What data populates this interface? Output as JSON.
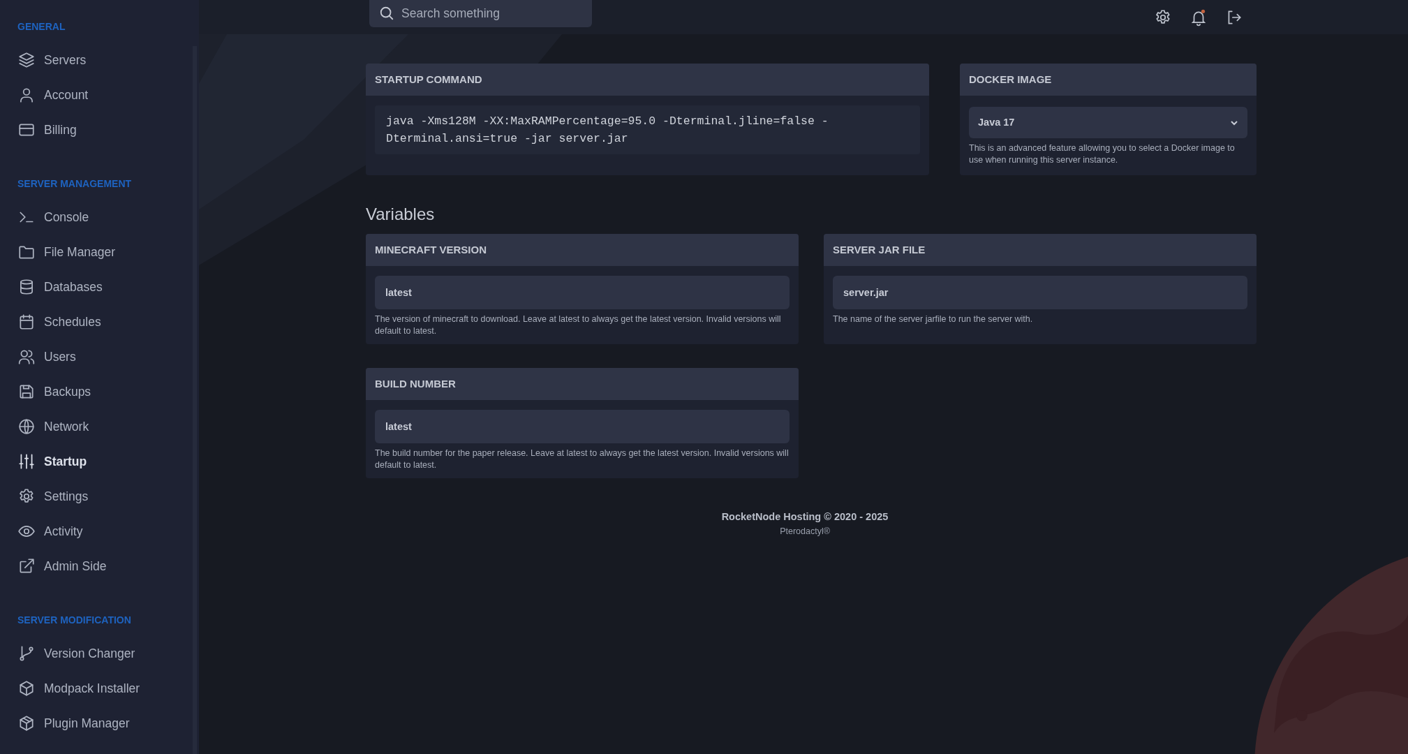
{
  "sidebar": {
    "sections": [
      {
        "heading": "GENERAL",
        "items": [
          {
            "label": "Servers",
            "selected": false
          },
          {
            "label": "Account",
            "selected": false
          },
          {
            "label": "Billing",
            "selected": false
          }
        ]
      },
      {
        "heading": "SERVER MANAGEMENT",
        "items": [
          {
            "label": "Console",
            "selected": false
          },
          {
            "label": "File Manager",
            "selected": false
          },
          {
            "label": "Databases",
            "selected": false
          },
          {
            "label": "Schedules",
            "selected": false
          },
          {
            "label": "Users",
            "selected": false
          },
          {
            "label": "Backups",
            "selected": false
          },
          {
            "label": "Network",
            "selected": false
          },
          {
            "label": "Startup",
            "selected": true
          },
          {
            "label": "Settings",
            "selected": false
          },
          {
            "label": "Activity",
            "selected": false
          },
          {
            "label": "Admin Side",
            "selected": false
          }
        ]
      },
      {
        "heading": "SERVER MODIFICATION",
        "items": [
          {
            "label": "Version Changer",
            "selected": false
          },
          {
            "label": "Modpack Installer",
            "selected": false
          },
          {
            "label": "Plugin Manager",
            "selected": false
          }
        ]
      }
    ]
  },
  "top_bar": {
    "search": {
      "placeholder": "Search something"
    }
  },
  "startup_command": {
    "title": "STARTUP COMMAND",
    "command": "java -Xms128M -XX:MaxRAMPercentage=95.0 -Dterminal.jline=false -Dterminal.ansi=true -jar server.jar"
  },
  "docker_image": {
    "title": "DOCKER IMAGE",
    "value": "Java 17",
    "help": "This is an advanced feature allowing you to select a Docker image to use when running this server instance."
  },
  "variables": {
    "heading": "Variables",
    "items": [
      {
        "title": "MINECRAFT VERSION",
        "value": "latest",
        "help": "The version of minecraft to download. Leave at latest to always get the latest version. Invalid versions will default to latest."
      },
      {
        "title": "SERVER JAR FILE",
        "value": "server.jar",
        "help": "The name of the server jarfile to run the server with."
      },
      {
        "title": "BUILD NUMBER",
        "value": "latest",
        "help": "The build number for the paper release. Leave at latest to always get the latest version. Invalid versions will default to latest."
      }
    ]
  },
  "footer": {
    "copyright": "RocketNode Hosting © 2020 - 2025",
    "credit": "Pterodactyl®"
  }
}
